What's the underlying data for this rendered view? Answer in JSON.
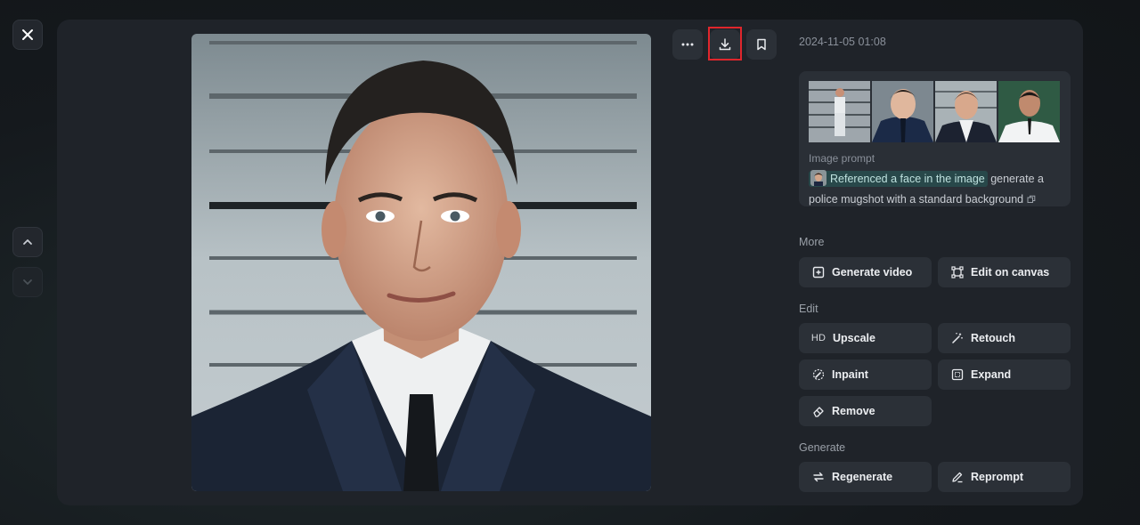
{
  "icons": {
    "close": "close-icon",
    "up": "chevron-up-icon",
    "down": "chevron-down-icon",
    "more": "more-horizontal-icon",
    "download": "download-icon",
    "bookmark": "bookmark-icon"
  },
  "image": {
    "timestamp": "2024-11-05 01:08"
  },
  "prompt": {
    "label": "Image prompt",
    "reference_chip": "Referenced a face in the image",
    "text": "generate a police mugshot with a standard background"
  },
  "sections": {
    "more": {
      "label": "More",
      "actions": [
        {
          "label": "Generate video",
          "icon": "video-plus-icon"
        },
        {
          "label": "Edit on canvas",
          "icon": "canvas-icon"
        }
      ]
    },
    "edit": {
      "label": "Edit",
      "actions": [
        {
          "label": "Upscale",
          "icon": "HD"
        },
        {
          "label": "Retouch",
          "icon": "magic-wand-icon"
        },
        {
          "label": "Inpaint",
          "icon": "inpaint-icon"
        },
        {
          "label": "Expand",
          "icon": "expand-icon"
        },
        {
          "label": "Remove",
          "icon": "eraser-icon"
        }
      ]
    },
    "generate": {
      "label": "Generate",
      "actions": [
        {
          "label": "Regenerate",
          "icon": "regenerate-icon"
        },
        {
          "label": "Reprompt",
          "icon": "pencil-icon"
        }
      ]
    }
  },
  "colors": {
    "accent_highlight": "#e0262c",
    "chip_bg": "#28484a"
  }
}
